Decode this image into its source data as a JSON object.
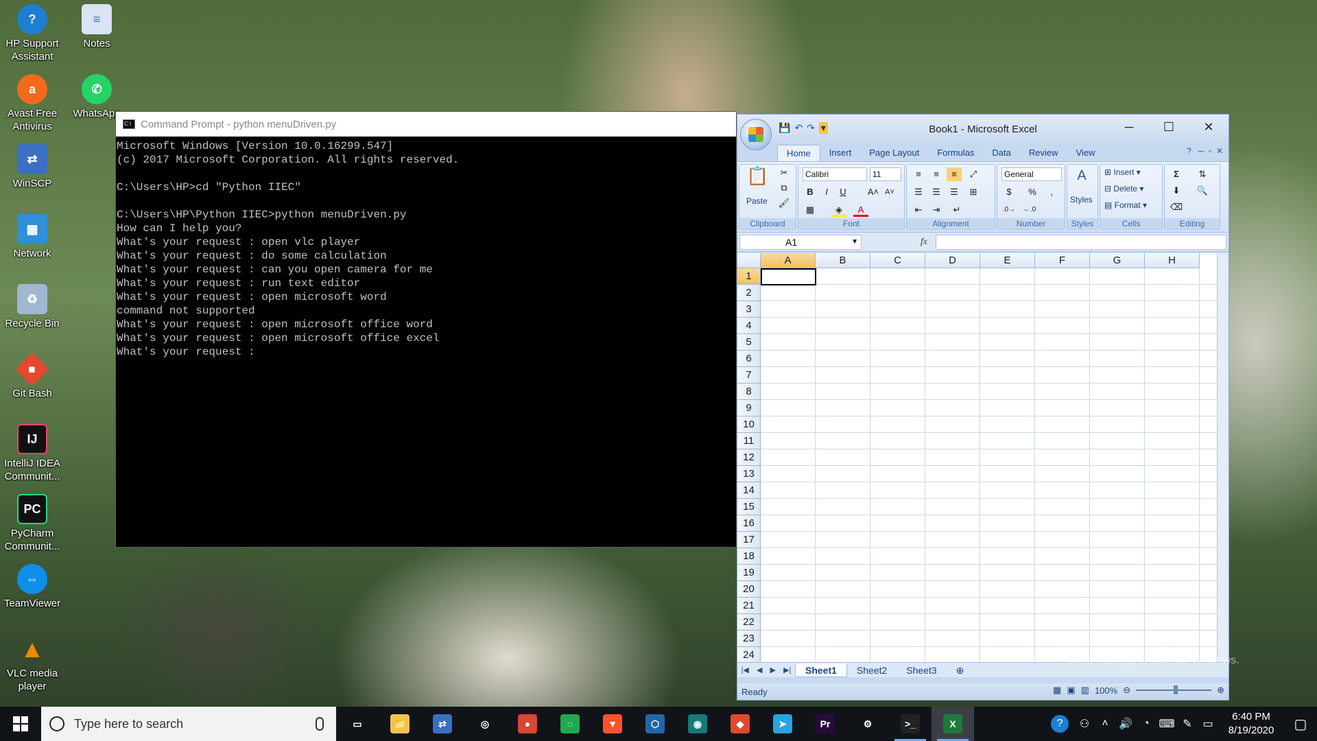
{
  "desktop": {
    "icons": [
      {
        "label": "HP Support Assistant",
        "color": "#1d7fd1",
        "glyph": "?"
      },
      {
        "label": "Notes",
        "color": "#d9e3f2",
        "glyph": "≡"
      },
      {
        "label": "Avast Free Antivirus",
        "color": "#f26b1d",
        "glyph": "a"
      },
      {
        "label": "WhatsApp",
        "color": "#25d366",
        "glyph": "✆"
      },
      {
        "label": "WinSCP",
        "color": "#3a6fc4",
        "glyph": "⇄"
      },
      {
        "label": "Network",
        "color": "#2f8fd8",
        "glyph": "🖧"
      },
      {
        "label": "Recycle Bin",
        "color": "#9fb7d0",
        "glyph": "♻"
      },
      {
        "label": "Git Bash",
        "color": "#e2492f",
        "glyph": "◆"
      },
      {
        "label": "IntelliJ IDEA Communit...",
        "color": "#111111",
        "glyph": "IJ"
      },
      {
        "label": "PyCharm Communit...",
        "color": "#111111",
        "glyph": "PC"
      },
      {
        "label": "TeamViewer",
        "color": "#0e8ee9",
        "glyph": "⇔"
      },
      {
        "label": "VLC media player",
        "color": "#f08a00",
        "glyph": "▲"
      }
    ]
  },
  "cmd": {
    "title": "Command Prompt - python  menuDriven.py",
    "lines": [
      "Microsoft Windows [Version 10.0.16299.547]",
      "(c) 2017 Microsoft Corporation. All rights reserved.",
      "",
      "C:\\Users\\HP>cd \"Python IIEC\"",
      "",
      "C:\\Users\\HP\\Python IIEC>python menuDriven.py",
      "How can I help you?",
      "What's your request : open vlc player",
      "What's your request : do some calculation",
      "What's your request : can you open camera for me",
      "What's your request : run text editor",
      "What's your request : open microsoft word",
      "command not supported",
      "What's your request : open microsoft office word",
      "What's your request : open microsoft office excel",
      "What's your request : "
    ]
  },
  "excel": {
    "title": "Book1 - Microsoft Excel",
    "tabs": [
      "Home",
      "Insert",
      "Page Layout",
      "Formulas",
      "Data",
      "Review",
      "View"
    ],
    "groups": {
      "clipboard": "Clipboard",
      "font": "Font",
      "alignment": "Alignment",
      "number": "Number",
      "styles": "Styles",
      "cells": "Cells",
      "editing": "Editing"
    },
    "paste_label": "Paste",
    "font_name": "Calibri",
    "font_size": "11",
    "number_format": "General",
    "cells_buttons": [
      "Insert",
      "Delete",
      "Format"
    ],
    "name_box": "A1",
    "fx": "fx",
    "columns": [
      "A",
      "B",
      "C",
      "D",
      "E",
      "F",
      "G",
      "H"
    ],
    "rows": [
      "1",
      "2",
      "3",
      "4",
      "5",
      "6",
      "7",
      "8",
      "9",
      "10",
      "11",
      "12",
      "13",
      "14",
      "15",
      "16",
      "17",
      "18",
      "19",
      "20",
      "21",
      "22",
      "23",
      "24"
    ],
    "sheets": [
      "Sheet1",
      "Sheet2",
      "Sheet3"
    ],
    "status": "Ready",
    "zoom": "100%"
  },
  "watermark": {
    "line1": "Activate Windows",
    "line2": "Go to Settings to activate Windows."
  },
  "taskbar": {
    "search_placeholder": "Type here to search",
    "apps": [
      {
        "name": "task-view",
        "glyph": "▭",
        "color": "#101418"
      },
      {
        "name": "file-explorer",
        "glyph": "📁",
        "color": "#f2c14e"
      },
      {
        "name": "winscp",
        "glyph": "⇄",
        "color": "#3a6fc4"
      },
      {
        "name": "media",
        "glyph": "◎",
        "color": "#101418"
      },
      {
        "name": "chrome",
        "glyph": "●",
        "color": "#db4437"
      },
      {
        "name": "app-green",
        "glyph": "◌",
        "color": "#1fa84f"
      },
      {
        "name": "brave",
        "glyph": "▼",
        "color": "#fb542b"
      },
      {
        "name": "virtualbox",
        "glyph": "⬡",
        "color": "#2266aa"
      },
      {
        "name": "gitkraken",
        "glyph": "◉",
        "color": "#147a7a"
      },
      {
        "name": "git",
        "glyph": "◆",
        "color": "#e2492f"
      },
      {
        "name": "telegram",
        "glyph": "➤",
        "color": "#2aa3e0"
      },
      {
        "name": "premiere",
        "glyph": "Pr",
        "color": "#2a0a3c"
      },
      {
        "name": "settings",
        "glyph": "⚙",
        "color": "#101418"
      },
      {
        "name": "cmd",
        "glyph": ">_",
        "color": "#222222"
      },
      {
        "name": "excel",
        "glyph": "X",
        "color": "#1d7a3a"
      }
    ],
    "time": "6:40 PM",
    "date": "8/19/2020"
  }
}
